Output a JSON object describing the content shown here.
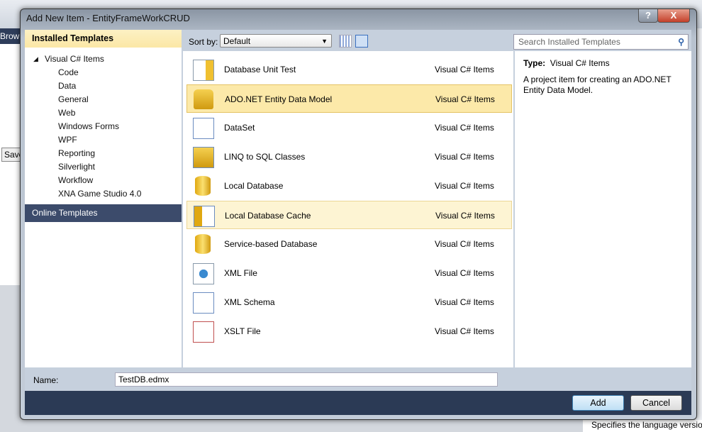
{
  "background": {
    "fragment_browse": "Brow",
    "fragment_save": "Save",
    "fragment_specifies": "Specifies the language versio"
  },
  "dialog": {
    "title": "Add New Item - EntityFrameWorkCRUD",
    "help": "?",
    "close": "X"
  },
  "left": {
    "header": "Installed Templates",
    "root": "Visual C# Items",
    "children": [
      "Code",
      "Data",
      "General",
      "Web",
      "Windows Forms",
      "WPF",
      "Reporting",
      "Silverlight",
      "Workflow",
      "XNA Game Studio 4.0"
    ],
    "selected": "Data",
    "online": "Online Templates"
  },
  "toolbar": {
    "sort_label": "Sort by:",
    "sort_value": "Default"
  },
  "search": {
    "placeholder": "Search Installed Templates"
  },
  "items": [
    {
      "name": "Database Unit Test",
      "type": "Visual C# Items",
      "icon": "database-unit-test-icon"
    },
    {
      "name": "ADO.NET Entity Data Model",
      "type": "Visual C# Items",
      "icon": "entity-model-icon"
    },
    {
      "name": "DataSet",
      "type": "Visual C# Items",
      "icon": "dataset-icon"
    },
    {
      "name": "LINQ to SQL Classes",
      "type": "Visual C# Items",
      "icon": "linq-icon"
    },
    {
      "name": "Local Database",
      "type": "Visual C# Items",
      "icon": "database-icon"
    },
    {
      "name": "Local Database Cache",
      "type": "Visual C# Items",
      "icon": "database-cache-icon"
    },
    {
      "name": "Service-based Database",
      "type": "Visual C# Items",
      "icon": "database-icon"
    },
    {
      "name": "XML File",
      "type": "Visual C# Items",
      "icon": "xml-file-icon"
    },
    {
      "name": "XML Schema",
      "type": "Visual C# Items",
      "icon": "xml-schema-icon"
    },
    {
      "name": "XSLT File",
      "type": "Visual C# Items",
      "icon": "xslt-file-icon"
    }
  ],
  "details": {
    "type_label": "Type:",
    "type_value": "Visual C# Items",
    "description": "A project item for creating an ADO.NET Entity Data Model."
  },
  "name_field": {
    "label": "Name:",
    "value": "TestDB.edmx"
  },
  "buttons": {
    "add": "Add",
    "cancel": "Cancel"
  }
}
